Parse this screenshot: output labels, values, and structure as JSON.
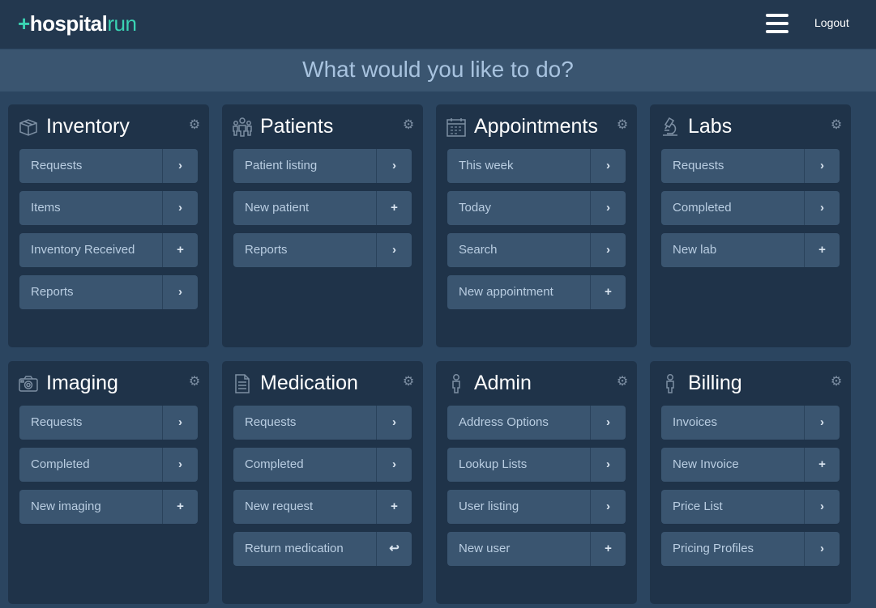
{
  "app": {
    "logo_plus": "+",
    "logo_main": "hospital",
    "logo_accent": "run",
    "logout": "Logout"
  },
  "prompt": "What would you like to do?",
  "colors": {
    "accent": "#3ad3b3",
    "card": "#1f3349",
    "action": "#3a5570",
    "background": "#2b4560"
  },
  "modules": [
    {
      "title": "Inventory",
      "icon": "box-icon",
      "actions": [
        {
          "label": "Requests",
          "glyph": "›",
          "icon": "chevron-right-icon"
        },
        {
          "label": "Items",
          "glyph": "›",
          "icon": "chevron-right-icon"
        },
        {
          "label": "Inventory Received",
          "glyph": "+",
          "icon": "plus-icon"
        },
        {
          "label": "Reports",
          "glyph": "›",
          "icon": "chevron-right-icon"
        }
      ]
    },
    {
      "title": "Patients",
      "icon": "people-icon",
      "actions": [
        {
          "label": "Patient listing",
          "glyph": "›",
          "icon": "chevron-right-icon"
        },
        {
          "label": "New patient",
          "glyph": "+",
          "icon": "plus-icon"
        },
        {
          "label": "Reports",
          "glyph": "›",
          "icon": "chevron-right-icon"
        }
      ]
    },
    {
      "title": "Appointments",
      "icon": "calendar-icon",
      "actions": [
        {
          "label": "This week",
          "glyph": "›",
          "icon": "chevron-right-icon"
        },
        {
          "label": "Today",
          "glyph": "›",
          "icon": "chevron-right-icon"
        },
        {
          "label": "Search",
          "glyph": "›",
          "icon": "chevron-right-icon"
        },
        {
          "label": "New appointment",
          "glyph": "+",
          "icon": "plus-icon"
        }
      ]
    },
    {
      "title": "Labs",
      "icon": "microscope-icon",
      "actions": [
        {
          "label": "Requests",
          "glyph": "›",
          "icon": "chevron-right-icon"
        },
        {
          "label": "Completed",
          "glyph": "›",
          "icon": "chevron-right-icon"
        },
        {
          "label": "New lab",
          "glyph": "+",
          "icon": "plus-icon"
        }
      ]
    },
    {
      "title": "Imaging",
      "icon": "camera-icon",
      "actions": [
        {
          "label": "Requests",
          "glyph": "›",
          "icon": "chevron-right-icon"
        },
        {
          "label": "Completed",
          "glyph": "›",
          "icon": "chevron-right-icon"
        },
        {
          "label": "New imaging",
          "glyph": "+",
          "icon": "plus-icon"
        }
      ]
    },
    {
      "title": "Medication",
      "icon": "document-icon",
      "actions": [
        {
          "label": "Requests",
          "glyph": "›",
          "icon": "chevron-right-icon"
        },
        {
          "label": "Completed",
          "glyph": "›",
          "icon": "chevron-right-icon"
        },
        {
          "label": "New request",
          "glyph": "+",
          "icon": "plus-icon"
        },
        {
          "label": "Return medication",
          "glyph": "↩",
          "icon": "reply-icon"
        }
      ]
    },
    {
      "title": "Admin",
      "icon": "person-icon",
      "actions": [
        {
          "label": "Address Options",
          "glyph": "›",
          "icon": "chevron-right-icon"
        },
        {
          "label": "Lookup Lists",
          "glyph": "›",
          "icon": "chevron-right-icon"
        },
        {
          "label": "User listing",
          "glyph": "›",
          "icon": "chevron-right-icon"
        },
        {
          "label": "New user",
          "glyph": "+",
          "icon": "plus-icon"
        }
      ]
    },
    {
      "title": "Billing",
      "icon": "person-icon",
      "actions": [
        {
          "label": "Invoices",
          "glyph": "›",
          "icon": "chevron-right-icon"
        },
        {
          "label": "New Invoice",
          "glyph": "+",
          "icon": "plus-icon"
        },
        {
          "label": "Price List",
          "glyph": "›",
          "icon": "chevron-right-icon"
        },
        {
          "label": "Pricing Profiles",
          "glyph": "›",
          "icon": "chevron-right-icon"
        }
      ]
    }
  ]
}
